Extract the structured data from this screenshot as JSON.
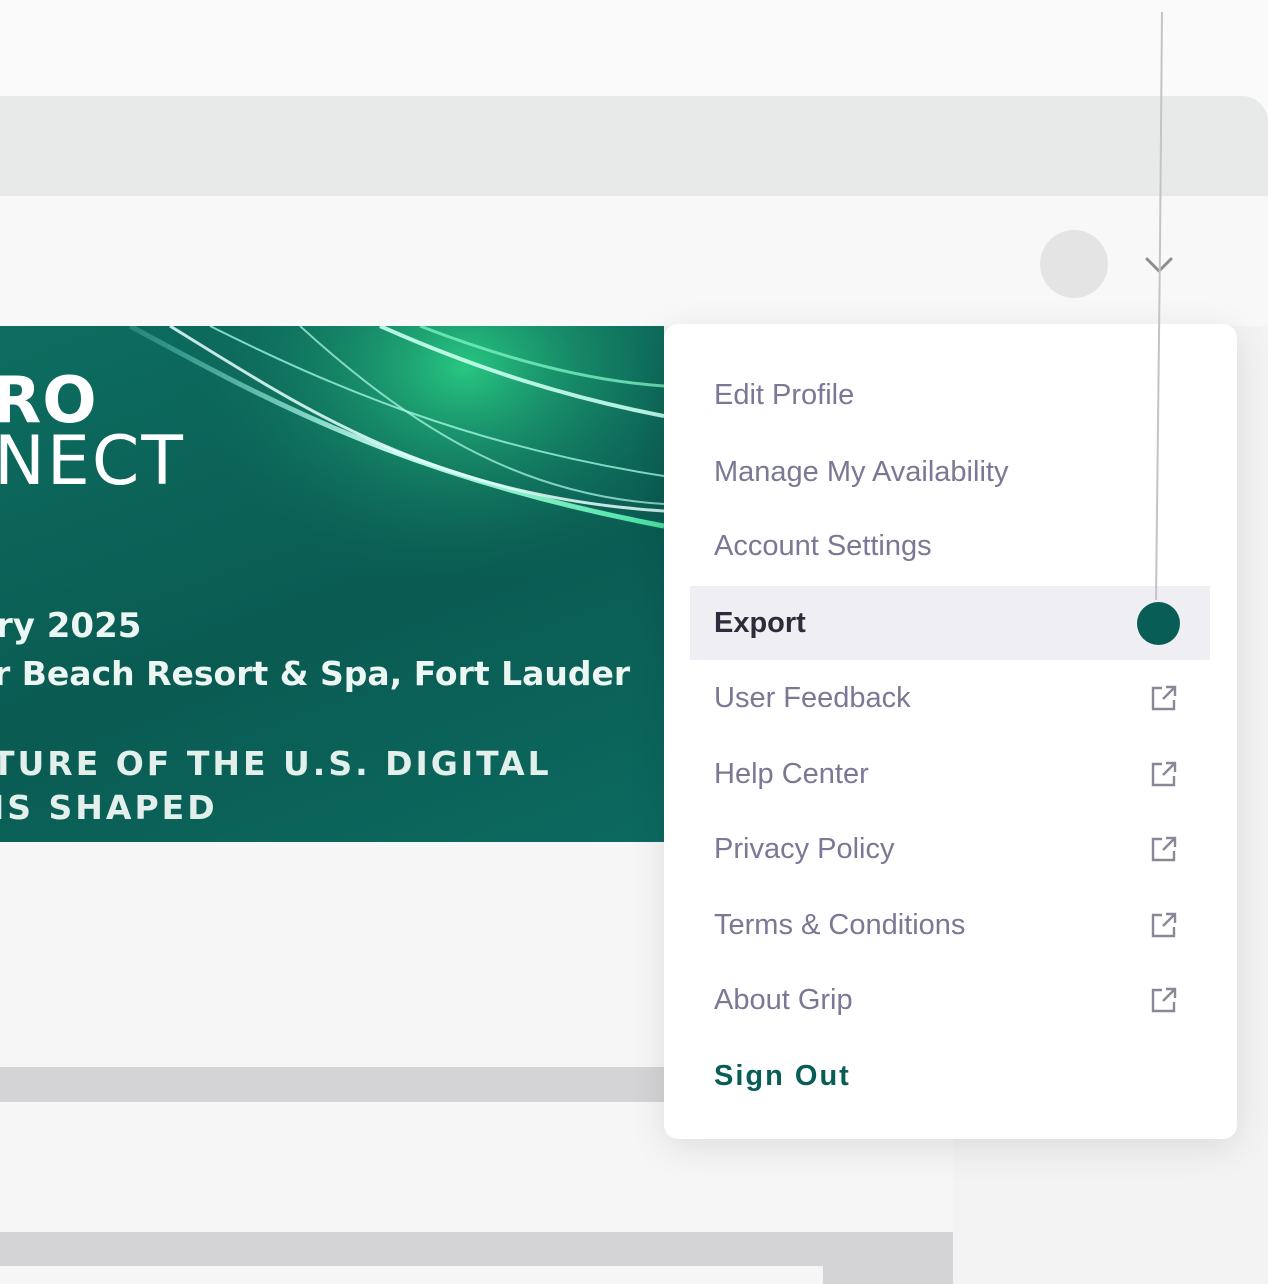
{
  "banner": {
    "line1": "RO",
    "line2": "NECT",
    "date": "ry 2025",
    "venue": "r Beach Resort & Spa, Fort Lauder",
    "tagline1": "TURE OF THE U.S. DIGITAL",
    "tagline2": "IS SHAPED"
  },
  "user_menu": {
    "items": [
      {
        "label": "Edit Profile",
        "external": false
      },
      {
        "label": "Manage My Availability",
        "external": false
      },
      {
        "label": "Account Settings",
        "external": false
      },
      {
        "label": "Export",
        "external": false,
        "active": true
      },
      {
        "label": "User Feedback",
        "external": true
      },
      {
        "label": "Help Center",
        "external": true
      },
      {
        "label": "Privacy Policy",
        "external": true
      },
      {
        "label": "Terms & Conditions",
        "external": true
      },
      {
        "label": "About Grip",
        "external": true
      }
    ],
    "sign_out": "Sign Out"
  },
  "colors": {
    "accent": "#085d57",
    "menu_text": "#7a7894",
    "active_bg": "#efeef3"
  },
  "icons": [
    "chevron-down-icon",
    "external-link-icon",
    "avatar"
  ]
}
